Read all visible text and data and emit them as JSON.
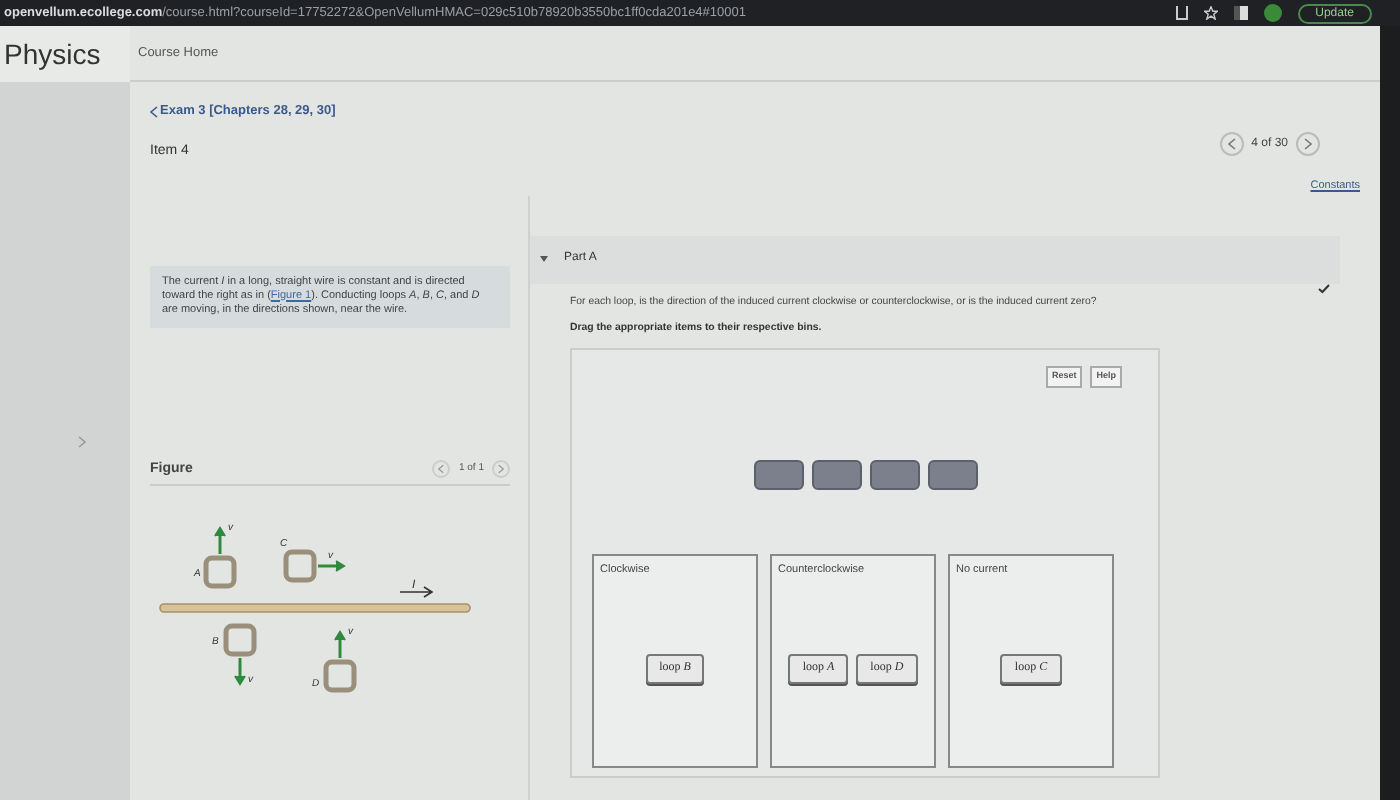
{
  "browser": {
    "url_host": "openvellum.ecollege.com",
    "url_path": "/course.html?courseId=17752272&OpenVellumHMAC=029c510b78920b3550bc1ff0cda201e4#10001",
    "update_button": "Update"
  },
  "header": {
    "title": "Physics",
    "nav": "Course Home"
  },
  "breadcrumb": "Exam 3 [Chapters 28, 29, 30]",
  "item_title": "Item 4",
  "pager": {
    "text": "4 of 30"
  },
  "constants_link": "Constants",
  "problem": {
    "before": "The current *I* in a long, straight wire is constant and is directed toward the right as in (",
    "link": "Figure 1",
    "after": "). Conducting loops *A*, *B*, *C*, and *D* are moving, in the directions shown, near the wire."
  },
  "figure": {
    "title": "Figure",
    "pager": "1 of 1",
    "current_label": "I",
    "loops": [
      {
        "label": "A",
        "velocity_label": "v",
        "kind": "up"
      },
      {
        "label": "C",
        "velocity_label": "v",
        "kind": "right"
      },
      {
        "label": "B",
        "velocity_label": "v",
        "kind": "down"
      },
      {
        "label": "D",
        "velocity_label": "v",
        "kind": "up"
      }
    ]
  },
  "part": {
    "title": "Part A",
    "expanded": true,
    "answered": true,
    "question": "For each loop, is the direction of the induced current clockwise or counterclockwise, or is the induced current zero?",
    "instruction": "Drag the appropriate items to their respective bins.",
    "buttons": [
      "Reset",
      "Help"
    ],
    "bins": [
      {
        "label": "Clockwise",
        "items": [
          "loop *B*"
        ]
      },
      {
        "label": "Counterclockwise",
        "items": [
          "loop *A*",
          "loop *D*"
        ]
      },
      {
        "label": "No current",
        "items": [
          "loop *C*"
        ]
      }
    ]
  }
}
